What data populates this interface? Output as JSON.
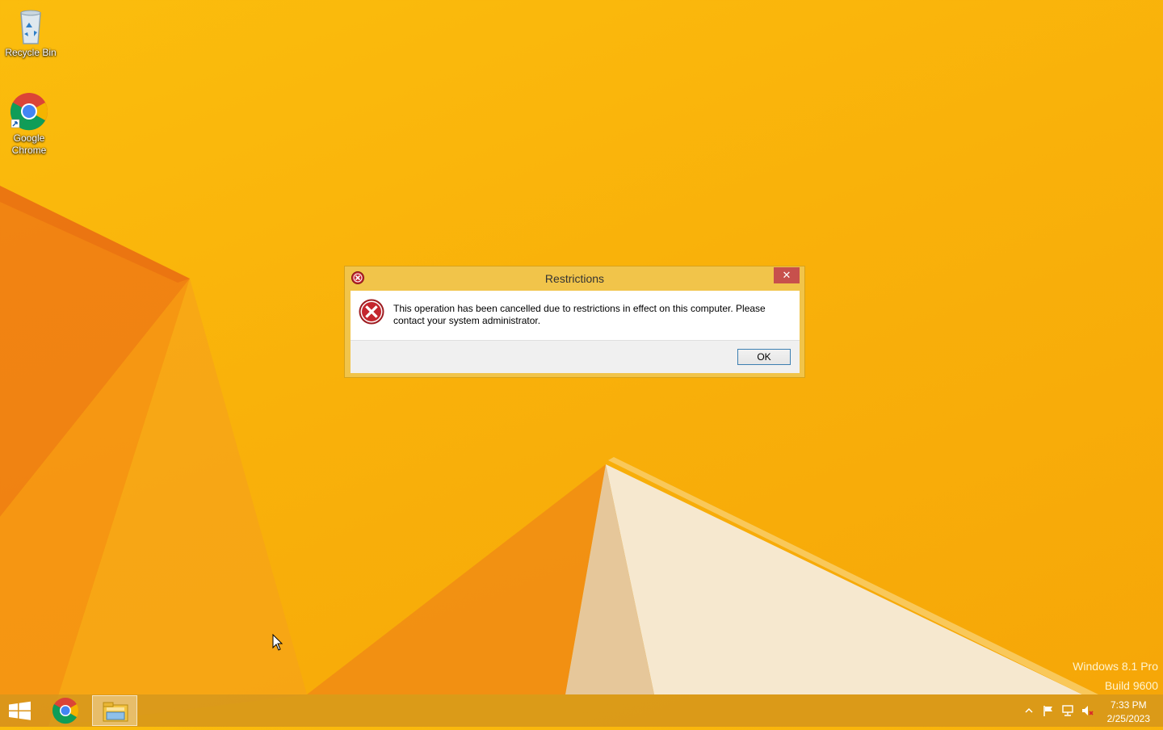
{
  "desktop": {
    "icons": [
      {
        "label": "Recycle Bin",
        "icon": "recycle-bin-icon"
      },
      {
        "label": "Google Chrome",
        "icon": "chrome-icon"
      }
    ]
  },
  "dialog": {
    "title": "Restrictions",
    "message": "This operation has been cancelled due to restrictions in effect on this computer. Please contact your system administrator.",
    "ok_label": "OK",
    "close_label": "✕",
    "icon": "error-icon"
  },
  "watermark": {
    "line1": "Windows 8.1 Pro",
    "line2": "Build 9600"
  },
  "taskbar": {
    "start_icon": "windows-start-icon",
    "pinned": [
      "chrome-icon",
      "file-explorer-icon"
    ],
    "tray_icons": [
      "show-hidden-icons-icon",
      "action-center-flag-icon",
      "network-icon",
      "volume-muted-icon"
    ],
    "time": "7:33 PM",
    "date": "2/25/2023"
  },
  "colors": {
    "wallpaper": "#f9b10a",
    "dialog_frame": "#f1c44a",
    "close_button": "#c7504c",
    "error_red": "#c4262e"
  }
}
